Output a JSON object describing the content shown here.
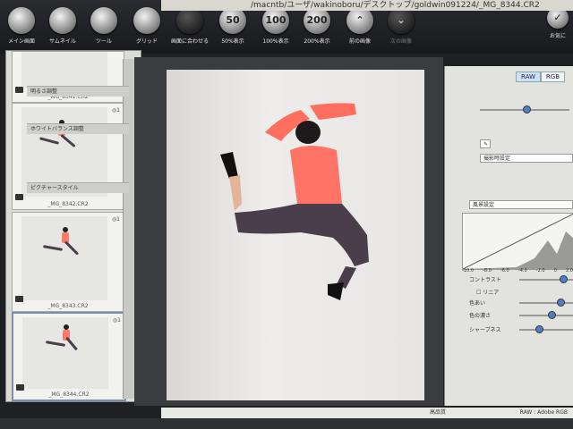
{
  "window": {
    "title": "/macntb/ユーザ/wakinoboru/デスクトップ/goldwin091224/_MG_8344.CR2"
  },
  "toolbar": {
    "items": [
      {
        "label": "メイン画面",
        "icon": "monitor-icon",
        "glyph": ""
      },
      {
        "label": "サムネイル",
        "icon": "thumbnails-icon",
        "glyph": ""
      },
      {
        "label": "ツール",
        "icon": "tool-icon",
        "glyph": ""
      },
      {
        "label": "グリッド",
        "icon": "grid-icon",
        "glyph": ""
      },
      {
        "label": "画面に合わせる",
        "icon": "fit-screen-icon",
        "glyph": ""
      },
      {
        "label": "50%表示",
        "icon": "zoom-50-icon",
        "glyph": "50"
      },
      {
        "label": "100%表示",
        "icon": "zoom-100-icon",
        "glyph": "100"
      },
      {
        "label": "200%表示",
        "icon": "zoom-200-icon",
        "glyph": "200"
      },
      {
        "label": "前の画像",
        "icon": "previous-image-icon",
        "glyph": "⌃"
      },
      {
        "label": "次の画像",
        "icon": "next-image-icon",
        "glyph": "⌄"
      },
      {
        "label": "お気に",
        "icon": "favorite-icon",
        "glyph": "✓"
      }
    ]
  },
  "thumbnails": [
    {
      "caption": "_MG_8341.CR2",
      "count": ""
    },
    {
      "caption": "_MG_8342.CR2",
      "count": "◎1"
    },
    {
      "caption": "_MG_8343.CR2",
      "count": "◎1"
    },
    {
      "caption": "_MG_8344.CR2",
      "count": "◎1"
    }
  ],
  "right_panel": {
    "tabs": [
      "RAW",
      "RGB"
    ],
    "sections": {
      "brightness": "明るさ調整",
      "white_balance": "ホワイトバランス調整",
      "white_balance_value": "撮影時設定",
      "picture_style": "ピクチャースタイル",
      "picture_style_value": "風景設定",
      "contrast": "コントラスト",
      "linear": "リニア",
      "hue": "色あい",
      "saturation": "色の濃さ",
      "sharpness": "シャープネス"
    },
    "histogram_labels": [
      "-10.0",
      "-8.0",
      "-6.0",
      "-4.0",
      "-2.0",
      "0",
      "2.0"
    ]
  },
  "status": {
    "right": "RAW : Adobe RGB",
    "center": "高品質"
  }
}
